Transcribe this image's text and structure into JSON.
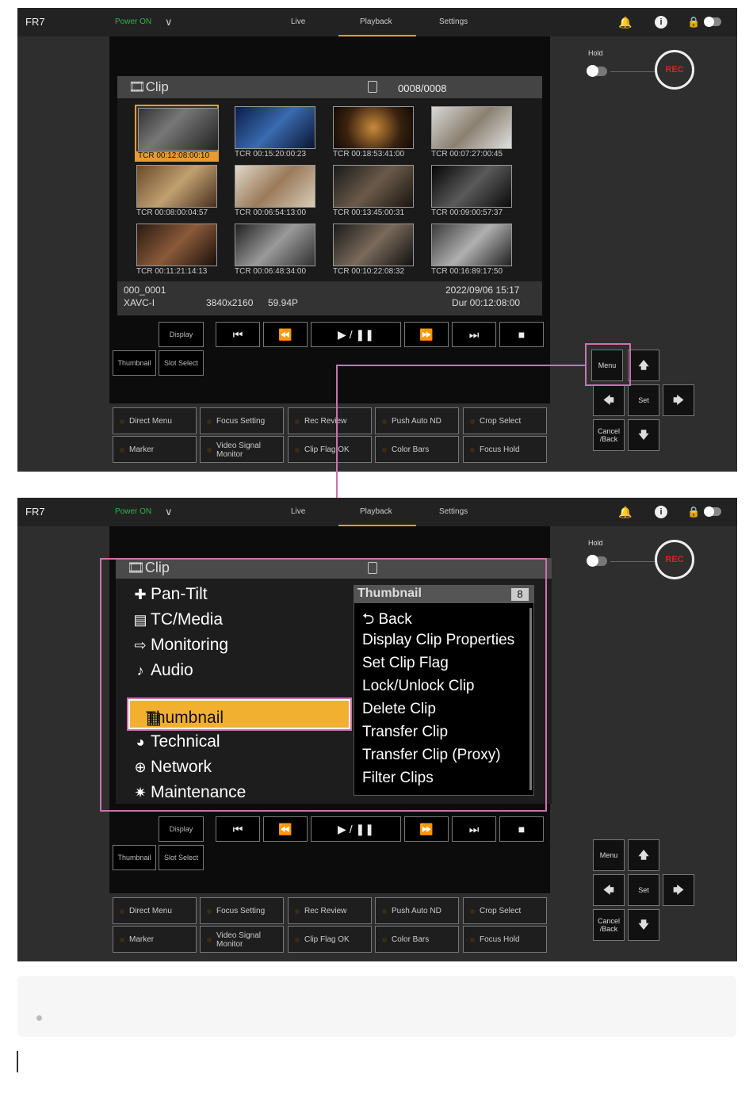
{
  "header": {
    "brand": "FR7",
    "power": "Power ON",
    "chevron": "∨",
    "tabs": {
      "live": "Live",
      "playback": "Playback",
      "settings": "Settings"
    },
    "icons": {
      "bell": "bell-icon",
      "info": "info-icon",
      "lock": "lock-icon",
      "toggle": "toggle-icon"
    },
    "bell_glyph": "🔔",
    "info_glyph": "i",
    "lock_glyph": "🔒"
  },
  "colors": {
    "accent": "#e89b2e",
    "power": "#2fb34a",
    "rec": "#e02020",
    "highlight": "#d070b0",
    "selected_menu": "#f2b030"
  },
  "clip_screen": {
    "title": "Clip",
    "counter": "0008/0008",
    "thumbnails": [
      "TCR 00:12:08:00:10",
      "TCR 00:15:20:00:23",
      "TCR 00:18:53:41:00",
      "TCR 00:07:27:00:45",
      "TCR 00:08:00:04:57",
      "TCR 00:06:54:13:00",
      "TCR 00:13:45:00:31",
      "TCR 00:09:00:57:37",
      "TCR 00:11:21:14:13",
      "TCR 00:06:48:34:00",
      "TCR 00:10:22:08:32",
      "TCR 00:16:89:17:50"
    ],
    "info": {
      "clip_name": "000_0001",
      "format": "XAVC-I",
      "resolution": "3840x2160",
      "frame_rate": "59.94P",
      "datetime": "2022/09/06 15:17",
      "duration": "Dur 00:12:08:00"
    }
  },
  "controls": {
    "display": "Display",
    "thumbnail": "Thumbnail",
    "slot_select": "Slot Select",
    "prev": "⏮",
    "rewind": "⏪",
    "play_pause": "▶ / ❚❚",
    "ffwd": "⏩",
    "next": "⏭",
    "stop": "■"
  },
  "function_buttons": {
    "row1": [
      "Direct Menu",
      "Focus Setting",
      "Rec Review",
      "Push Auto ND",
      "Crop Select"
    ],
    "row2": [
      "Marker",
      "Video Signal\nMonitor",
      "Clip Flag OK",
      "Color Bars",
      "Focus Hold"
    ]
  },
  "side_panel": {
    "hold": "Hold",
    "rec": "REC",
    "menu": "Menu",
    "set": "Set",
    "cancel_back": "Cancel\n/Back",
    "up": "🡅",
    "down": "🡇",
    "left": "🡄",
    "right": "🡆"
  },
  "menu": {
    "title": "Clip",
    "items": [
      {
        "icon": "move-icon",
        "glyph": "✚",
        "label": "Pan-Tilt"
      },
      {
        "icon": "timecode-icon",
        "glyph": "▤",
        "label": "TC/Media"
      },
      {
        "icon": "monitor-out-icon",
        "glyph": "⇨",
        "label": "Monitoring"
      },
      {
        "icon": "audio-icon",
        "glyph": "♪",
        "label": "Audio"
      },
      {
        "icon": "thumbnail-icon",
        "glyph": "▦",
        "label": "Thumbnail"
      },
      {
        "icon": "technical-icon",
        "glyph": "◕",
        "label": "Technical"
      },
      {
        "icon": "globe-icon",
        "glyph": "⊕",
        "label": "Network"
      },
      {
        "icon": "gear-icon",
        "glyph": "✷",
        "label": "Maintenance"
      }
    ],
    "submenu": {
      "title": "Thumbnail",
      "count": "8",
      "items": [
        "⮌ Back",
        "Display Clip Properties",
        "Set Clip Flag",
        "Lock/Unlock Clip",
        "Delete Clip",
        "Transfer Clip",
        "Transfer Clip (Proxy)",
        "Filter Clips"
      ]
    }
  }
}
